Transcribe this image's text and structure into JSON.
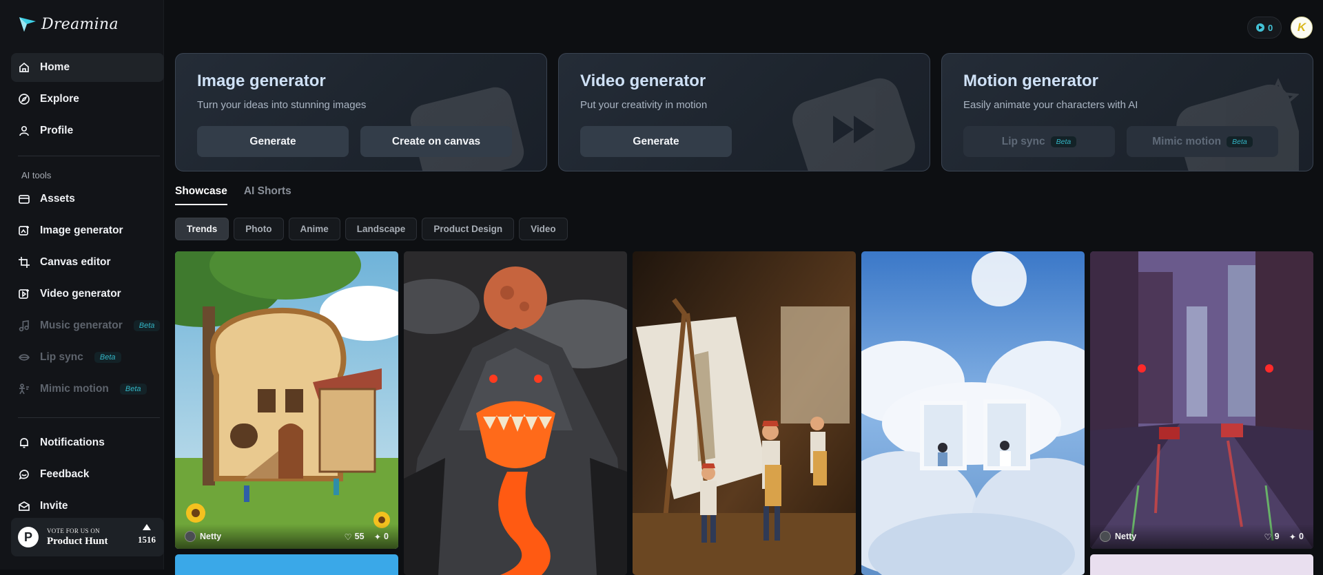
{
  "brand": {
    "name": "Dreamina"
  },
  "sidebar": {
    "main": [
      {
        "label": "Home",
        "icon": "home-icon",
        "active": true
      },
      {
        "label": "Explore",
        "icon": "compass-icon"
      },
      {
        "label": "Profile",
        "icon": "user-icon"
      }
    ],
    "section_label": "AI tools",
    "tools": [
      {
        "label": "Assets",
        "icon": "folder-icon"
      },
      {
        "label": "Image generator",
        "icon": "image-plus-icon"
      },
      {
        "label": "Canvas editor",
        "icon": "crop-icon"
      },
      {
        "label": "Video generator",
        "icon": "video-plus-icon"
      },
      {
        "label": "Music generator",
        "icon": "music-icon",
        "badge": "Beta",
        "disabled": true
      },
      {
        "label": "Lip sync",
        "icon": "lip-sync-icon",
        "badge": "Beta",
        "disabled": true
      },
      {
        "label": "Mimic motion",
        "icon": "motion-icon",
        "badge": "Beta",
        "disabled": true
      }
    ],
    "bottom": [
      {
        "label": "Notifications",
        "icon": "bell-icon"
      },
      {
        "label": "Feedback",
        "icon": "feedback-icon"
      },
      {
        "label": "Invite",
        "icon": "invite-icon"
      }
    ],
    "product_hunt": {
      "logo": "P",
      "small": "VOTE FOR US ON",
      "big": "Product Hunt",
      "votes": "1516"
    }
  },
  "header": {
    "credits": "0",
    "avatar_initial": "K"
  },
  "cards": [
    {
      "title": "Image generator",
      "subtitle": "Turn your ideas into stunning images",
      "buttons": [
        {
          "label": "Generate"
        },
        {
          "label": "Create on canvas"
        }
      ]
    },
    {
      "title": "Video generator",
      "subtitle": "Put your creativity in motion",
      "buttons": [
        {
          "label": "Generate"
        }
      ]
    },
    {
      "title": "Motion generator",
      "subtitle": "Easily animate your characters with AI",
      "buttons": [
        {
          "label": "Lip sync",
          "badge": "Beta",
          "disabled": true
        },
        {
          "label": "Mimic motion",
          "badge": "Beta",
          "disabled": true
        }
      ]
    }
  ],
  "tabs": [
    {
      "label": "Showcase",
      "active": true
    },
    {
      "label": "AI Shorts"
    }
  ],
  "filters": [
    {
      "label": "Trends",
      "active": true
    },
    {
      "label": "Photo"
    },
    {
      "label": "Anime"
    },
    {
      "label": "Landscape"
    },
    {
      "label": "Product Design"
    },
    {
      "label": "Video"
    }
  ],
  "gallery": [
    {
      "subject": "bread-house",
      "author": "Netty",
      "likes": "55",
      "remixes": "0"
    },
    {
      "subject": "lava-monster-mountain"
    },
    {
      "subject": "miniature-painters"
    },
    {
      "subject": "cloud-windows"
    },
    {
      "subject": "rainy-city-street",
      "author": "Netty",
      "likes": "9",
      "remixes": "0"
    }
  ],
  "colors": {
    "accent": "#43c2d6",
    "beta_text": "#33b5c5",
    "card_title": "#cfe1f6"
  }
}
